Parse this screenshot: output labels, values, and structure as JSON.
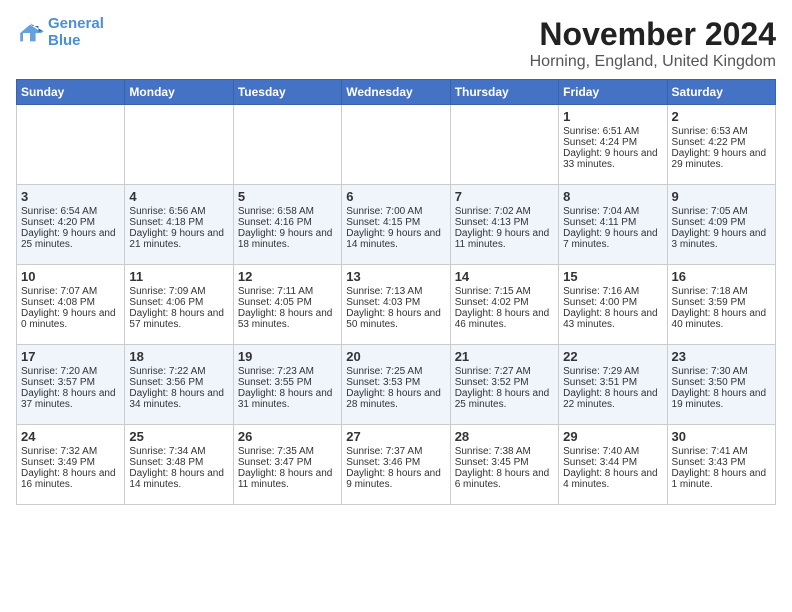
{
  "logo": {
    "line1": "General",
    "line2": "Blue"
  },
  "title": "November 2024",
  "location": "Horning, England, United Kingdom",
  "days_of_week": [
    "Sunday",
    "Monday",
    "Tuesday",
    "Wednesday",
    "Thursday",
    "Friday",
    "Saturday"
  ],
  "weeks": [
    [
      {
        "day": "",
        "info": ""
      },
      {
        "day": "",
        "info": ""
      },
      {
        "day": "",
        "info": ""
      },
      {
        "day": "",
        "info": ""
      },
      {
        "day": "",
        "info": ""
      },
      {
        "day": "1",
        "info": "Sunrise: 6:51 AM\nSunset: 4:24 PM\nDaylight: 9 hours and 33 minutes."
      },
      {
        "day": "2",
        "info": "Sunrise: 6:53 AM\nSunset: 4:22 PM\nDaylight: 9 hours and 29 minutes."
      }
    ],
    [
      {
        "day": "3",
        "info": "Sunrise: 6:54 AM\nSunset: 4:20 PM\nDaylight: 9 hours and 25 minutes."
      },
      {
        "day": "4",
        "info": "Sunrise: 6:56 AM\nSunset: 4:18 PM\nDaylight: 9 hours and 21 minutes."
      },
      {
        "day": "5",
        "info": "Sunrise: 6:58 AM\nSunset: 4:16 PM\nDaylight: 9 hours and 18 minutes."
      },
      {
        "day": "6",
        "info": "Sunrise: 7:00 AM\nSunset: 4:15 PM\nDaylight: 9 hours and 14 minutes."
      },
      {
        "day": "7",
        "info": "Sunrise: 7:02 AM\nSunset: 4:13 PM\nDaylight: 9 hours and 11 minutes."
      },
      {
        "day": "8",
        "info": "Sunrise: 7:04 AM\nSunset: 4:11 PM\nDaylight: 9 hours and 7 minutes."
      },
      {
        "day": "9",
        "info": "Sunrise: 7:05 AM\nSunset: 4:09 PM\nDaylight: 9 hours and 3 minutes."
      }
    ],
    [
      {
        "day": "10",
        "info": "Sunrise: 7:07 AM\nSunset: 4:08 PM\nDaylight: 9 hours and 0 minutes."
      },
      {
        "day": "11",
        "info": "Sunrise: 7:09 AM\nSunset: 4:06 PM\nDaylight: 8 hours and 57 minutes."
      },
      {
        "day": "12",
        "info": "Sunrise: 7:11 AM\nSunset: 4:05 PM\nDaylight: 8 hours and 53 minutes."
      },
      {
        "day": "13",
        "info": "Sunrise: 7:13 AM\nSunset: 4:03 PM\nDaylight: 8 hours and 50 minutes."
      },
      {
        "day": "14",
        "info": "Sunrise: 7:15 AM\nSunset: 4:02 PM\nDaylight: 8 hours and 46 minutes."
      },
      {
        "day": "15",
        "info": "Sunrise: 7:16 AM\nSunset: 4:00 PM\nDaylight: 8 hours and 43 minutes."
      },
      {
        "day": "16",
        "info": "Sunrise: 7:18 AM\nSunset: 3:59 PM\nDaylight: 8 hours and 40 minutes."
      }
    ],
    [
      {
        "day": "17",
        "info": "Sunrise: 7:20 AM\nSunset: 3:57 PM\nDaylight: 8 hours and 37 minutes."
      },
      {
        "day": "18",
        "info": "Sunrise: 7:22 AM\nSunset: 3:56 PM\nDaylight: 8 hours and 34 minutes."
      },
      {
        "day": "19",
        "info": "Sunrise: 7:23 AM\nSunset: 3:55 PM\nDaylight: 8 hours and 31 minutes."
      },
      {
        "day": "20",
        "info": "Sunrise: 7:25 AM\nSunset: 3:53 PM\nDaylight: 8 hours and 28 minutes."
      },
      {
        "day": "21",
        "info": "Sunrise: 7:27 AM\nSunset: 3:52 PM\nDaylight: 8 hours and 25 minutes."
      },
      {
        "day": "22",
        "info": "Sunrise: 7:29 AM\nSunset: 3:51 PM\nDaylight: 8 hours and 22 minutes."
      },
      {
        "day": "23",
        "info": "Sunrise: 7:30 AM\nSunset: 3:50 PM\nDaylight: 8 hours and 19 minutes."
      }
    ],
    [
      {
        "day": "24",
        "info": "Sunrise: 7:32 AM\nSunset: 3:49 PM\nDaylight: 8 hours and 16 minutes."
      },
      {
        "day": "25",
        "info": "Sunrise: 7:34 AM\nSunset: 3:48 PM\nDaylight: 8 hours and 14 minutes."
      },
      {
        "day": "26",
        "info": "Sunrise: 7:35 AM\nSunset: 3:47 PM\nDaylight: 8 hours and 11 minutes."
      },
      {
        "day": "27",
        "info": "Sunrise: 7:37 AM\nSunset: 3:46 PM\nDaylight: 8 hours and 9 minutes."
      },
      {
        "day": "28",
        "info": "Sunrise: 7:38 AM\nSunset: 3:45 PM\nDaylight: 8 hours and 6 minutes."
      },
      {
        "day": "29",
        "info": "Sunrise: 7:40 AM\nSunset: 3:44 PM\nDaylight: 8 hours and 4 minutes."
      },
      {
        "day": "30",
        "info": "Sunrise: 7:41 AM\nSunset: 3:43 PM\nDaylight: 8 hours and 1 minute."
      }
    ]
  ]
}
